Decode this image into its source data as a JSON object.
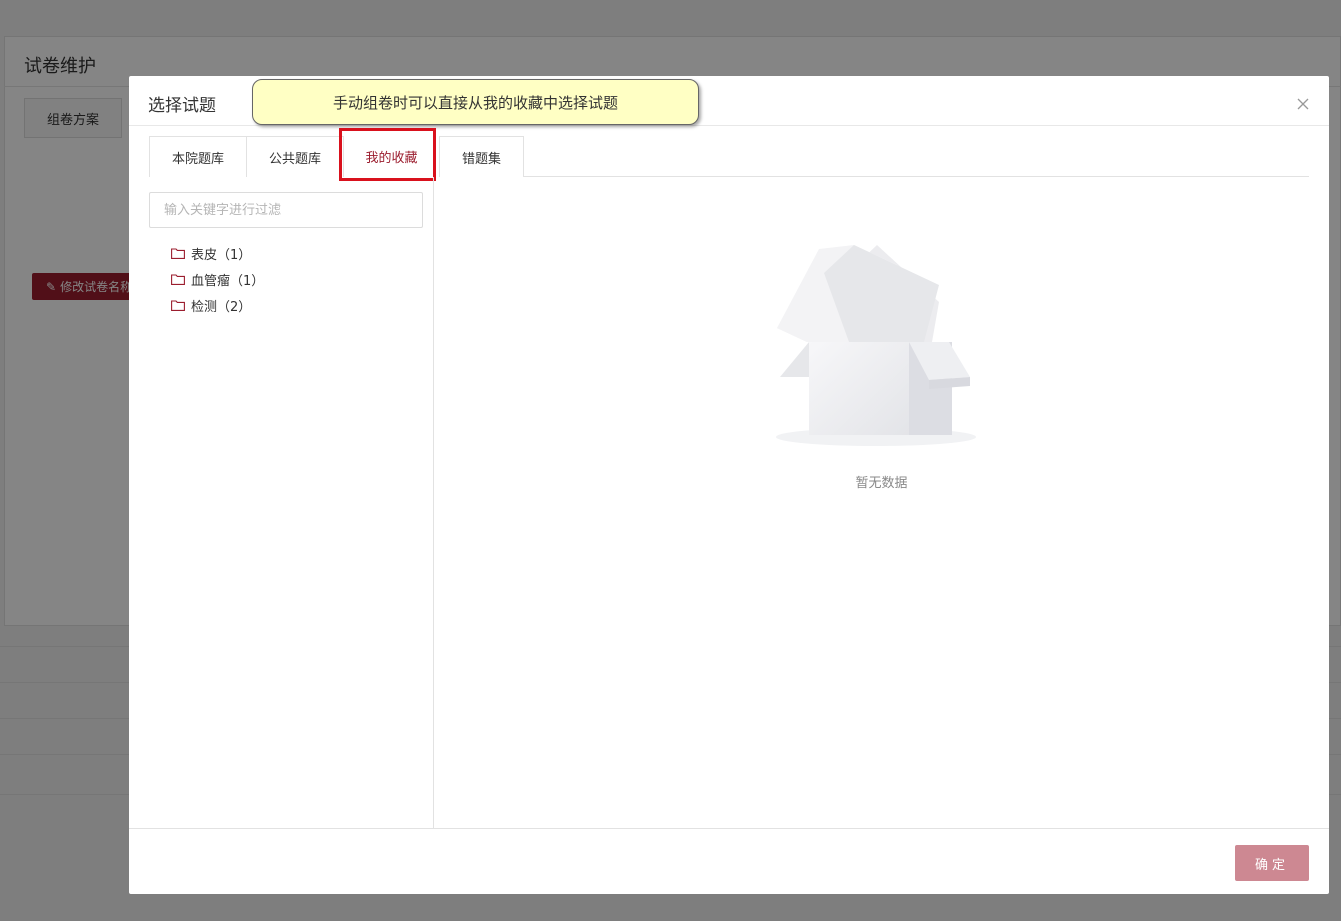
{
  "background": {
    "title": "试卷维护",
    "tab_label": "组卷方案",
    "edit_button_label": "修改试卷名称"
  },
  "modal": {
    "title": "选择试题",
    "tip": "手动组卷时可以直接从我的收藏中选择试题",
    "tabs": [
      {
        "label": "本院题库"
      },
      {
        "label": "公共题库"
      },
      {
        "label": "我的收藏"
      },
      {
        "label": "错题集"
      }
    ],
    "active_tab": "我的收藏",
    "filter": {
      "placeholder": "输入关键字进行过滤",
      "value": ""
    },
    "tree": [
      {
        "label": "表皮（1）"
      },
      {
        "label": "血管瘤（1）"
      },
      {
        "label": "检测（2）"
      }
    ],
    "empty_text": "暂无数据",
    "ok_label": "确定"
  },
  "colors": {
    "accent": "#9b1d2e",
    "highlight_border": "#d9111d",
    "ok_button": "#cd8892",
    "tip_bg": "#ffffc4"
  },
  "icons": {
    "folder": "folder-icon",
    "close": "close-icon",
    "empty": "empty-box-icon"
  }
}
